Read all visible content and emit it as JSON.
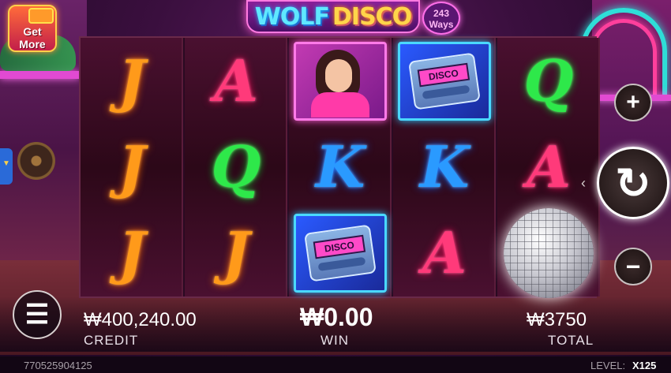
{
  "game": {
    "logo_part1": "WOLF",
    "logo_part2": "DISCO",
    "ways_number": "243",
    "ways_label": "Ways"
  },
  "promo": {
    "get_more_line1": "Get",
    "get_more_line2": "More"
  },
  "reels": [
    [
      "J",
      "J",
      "J"
    ],
    [
      "A",
      "Q",
      "J"
    ],
    [
      "woman",
      "K",
      "pager"
    ],
    [
      "pager",
      "K",
      "A"
    ],
    [
      "Q",
      "A",
      "disco-ball"
    ]
  ],
  "pager_text": "DISCO",
  "controls": {
    "plus": "+",
    "minus": "−",
    "spin": "↻",
    "spin_arrow": "‹",
    "menu": "☰"
  },
  "info": {
    "credit_value": "₩400,240.00",
    "credit_label": "CREDIT",
    "win_value": "₩0.00",
    "win_label": "WIN",
    "total_value": "₩3750",
    "total_label": "TOTAL"
  },
  "footer": {
    "session_id": "770525904125",
    "level_label": "LEVEL:",
    "level_value": "X125"
  },
  "colors": {
    "J": "#ff9a1a",
    "A": "#ff3a7a",
    "Q": "#2ee84a",
    "K": "#2a9aff"
  }
}
